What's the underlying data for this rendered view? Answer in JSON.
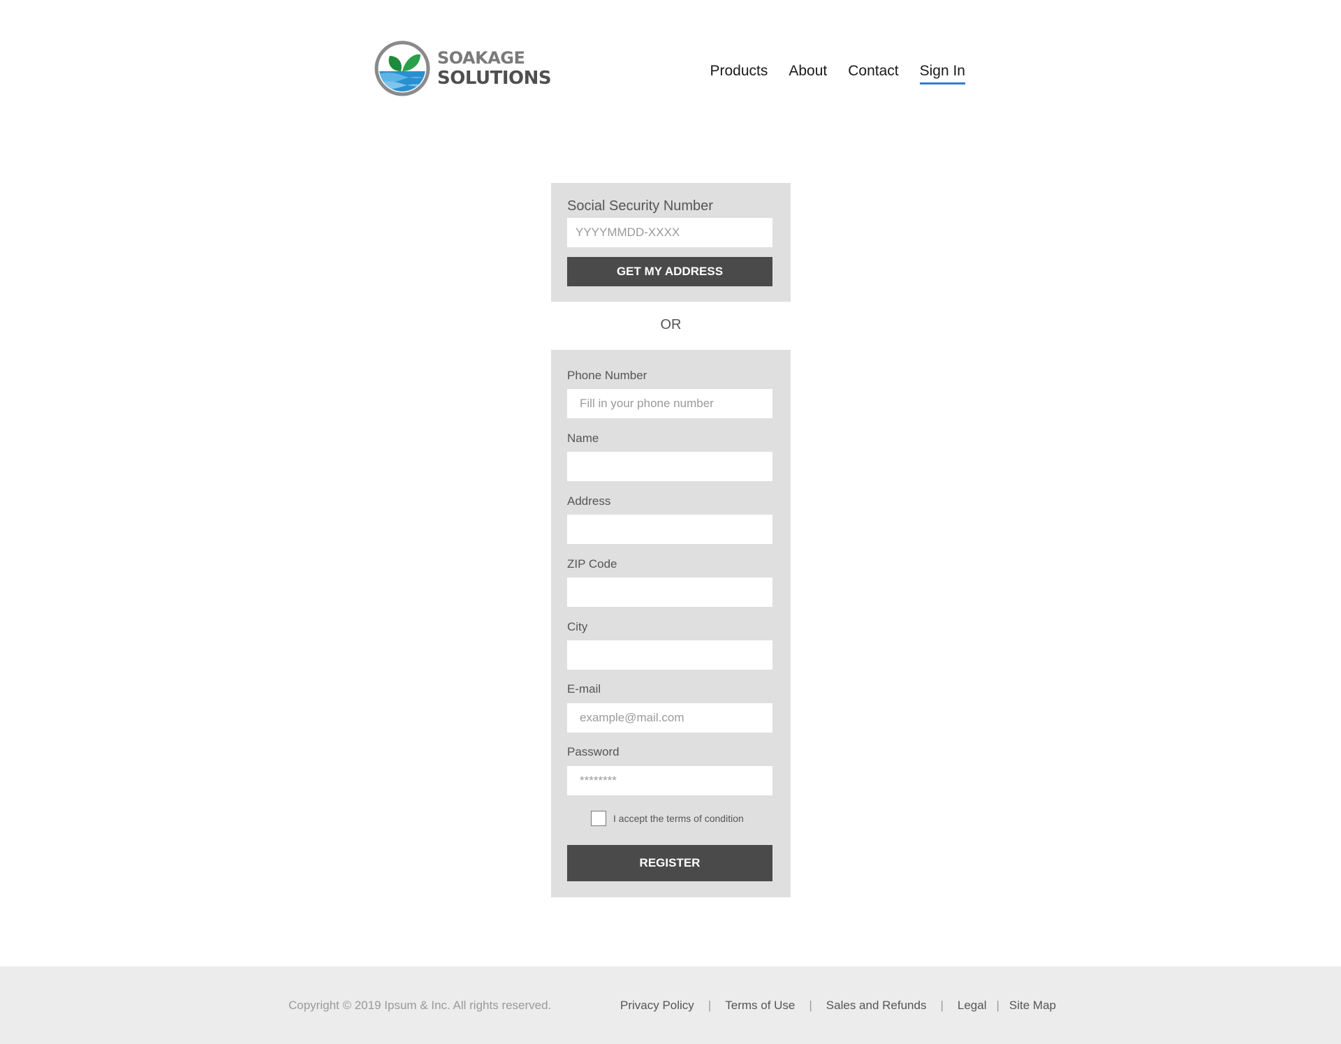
{
  "brand": {
    "name_line1": "SOAKAGE",
    "name_line2": "SOLUTIONS",
    "colors": {
      "leaf": "#1f8a3a",
      "water": "#2a8fd0",
      "ring": "#8a8a8a"
    }
  },
  "nav": {
    "items": [
      {
        "label": "Products",
        "active": false
      },
      {
        "label": "About",
        "active": false
      },
      {
        "label": "Contact",
        "active": false
      },
      {
        "label": "Sign In",
        "active": true
      }
    ],
    "active_underline_color": "#2e7fd1"
  },
  "ssn_form": {
    "label": "Social Security Number",
    "placeholder": "YYYYMMDD-XXXX",
    "value": "",
    "button_label": "GET MY ADDRESS"
  },
  "separator": "OR",
  "register_form": {
    "fields": [
      {
        "label": "Phone Number",
        "placeholder": "Fill in your phone number",
        "value": ""
      },
      {
        "label": "Name",
        "placeholder": "",
        "value": ""
      },
      {
        "label": "Address",
        "placeholder": "",
        "value": ""
      },
      {
        "label": "ZIP Code",
        "placeholder": "",
        "value": ""
      },
      {
        "label": "City",
        "placeholder": "",
        "value": ""
      },
      {
        "label": "E-mail",
        "placeholder": "example@mail.com",
        "value": ""
      },
      {
        "label": "Password",
        "placeholder": "********",
        "value": ""
      }
    ],
    "terms_label": "I accept the terms of condition",
    "terms_checked": false,
    "button_label": "REGISTER"
  },
  "footer": {
    "copyright": "Copyright © 2019 Ipsum & Inc. All rights reserved.",
    "links": [
      "Privacy Policy",
      "Terms of Use",
      "Sales and Refunds",
      "Legal",
      "Site Map"
    ],
    "separator": "|"
  },
  "colors": {
    "card_bg": "#dfdfdf",
    "button_bg": "#4a4a4a",
    "footer_bg": "#ececec"
  }
}
